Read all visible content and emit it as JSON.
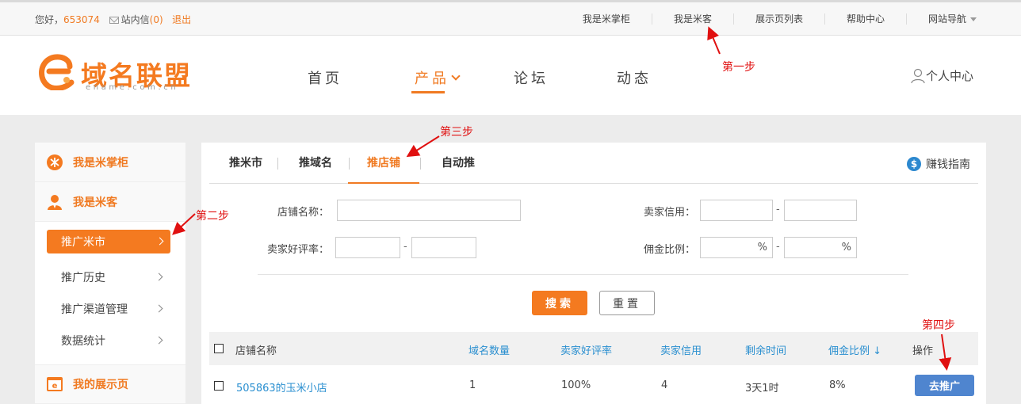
{
  "topbar": {
    "greeting": "您好，",
    "username": "653074",
    "messages_label": "站内信",
    "messages_count": "(0)",
    "logout": "退出",
    "links": [
      "我是米掌柜",
      "我是米客",
      "展示页列表",
      "帮助中心",
      "网站导航"
    ]
  },
  "header": {
    "logo_text": "域名联盟",
    "logo_subtext": "ename.com.cn",
    "nav": [
      "首页",
      "产品",
      "论坛",
      "动态"
    ],
    "active_nav": "产品",
    "user_center": "个人中心"
  },
  "annotations": {
    "step1": "第一步",
    "step2": "第二步",
    "step3": "第三步",
    "step4": "第四步"
  },
  "sidebar": {
    "sections": [
      "我是米掌柜",
      "我是米客",
      "我的展示页"
    ],
    "items": [
      "推广米市",
      "推广历史",
      "推广渠道管理",
      "数据统计"
    ],
    "active_item": "推广米市"
  },
  "tabs": {
    "items": [
      "推米市",
      "推域名",
      "推店铺",
      "自动推"
    ],
    "active": "推店铺",
    "guide": "赚钱指南"
  },
  "filters": {
    "shop_name_label": "店铺名称：",
    "seller_credit_label": "卖家信用：",
    "seller_rating_label": "卖家好评率：",
    "commission_label": "佣金比例：",
    "range_separator": "-",
    "percent_unit": "%",
    "search_button": "搜索",
    "reset_button": "重置"
  },
  "table": {
    "headers": [
      "店铺名称",
      "域名数量",
      "卖家好评率",
      "卖家信用",
      "剩余时间",
      "佣金比例 ↓",
      "操作"
    ],
    "rows": [
      {
        "shop": "505863的玉米小店",
        "domain_count": "1",
        "rating": "100%",
        "credit": "4",
        "remaining": "3天1时",
        "commission": "8%",
        "action": "去推广"
      }
    ]
  },
  "colors": {
    "brand_orange": "#f47a20",
    "link_blue": "#2a8fd0",
    "action_blue": "#4f85cf",
    "annotation_red": "#e01010"
  }
}
